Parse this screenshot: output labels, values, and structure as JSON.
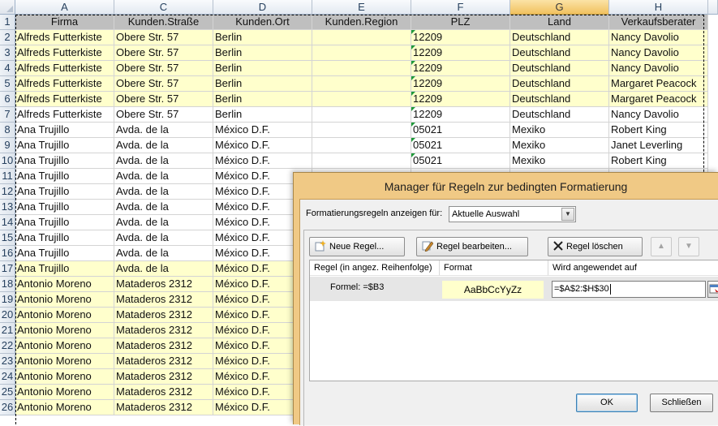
{
  "columns": [
    {
      "letter": "A",
      "header": "Firma"
    },
    {
      "letter": "C",
      "header": "Kunden.Straße"
    },
    {
      "letter": "D",
      "header": "Kunden.Ort"
    },
    {
      "letter": "E",
      "header": "Kunden.Region"
    },
    {
      "letter": "F",
      "header": "PLZ"
    },
    {
      "letter": "G",
      "header": "Land"
    },
    {
      "letter": "H",
      "header": "Verkaufsberater"
    }
  ],
  "rows": [
    {
      "num": "2",
      "hl": true,
      "cells": [
        "Alfreds Futterkiste",
        "Obere Str. 57",
        "Berlin",
        "",
        "12209",
        "Deutschland",
        "Nancy Davolio"
      ]
    },
    {
      "num": "3",
      "hl": true,
      "cells": [
        "Alfreds Futterkiste",
        "Obere Str. 57",
        "Berlin",
        "",
        "12209",
        "Deutschland",
        "Nancy Davolio"
      ]
    },
    {
      "num": "4",
      "hl": true,
      "cells": [
        "Alfreds Futterkiste",
        "Obere Str. 57",
        "Berlin",
        "",
        "12209",
        "Deutschland",
        "Nancy Davolio"
      ]
    },
    {
      "num": "5",
      "hl": true,
      "cells": [
        "Alfreds Futterkiste",
        "Obere Str. 57",
        "Berlin",
        "",
        "12209",
        "Deutschland",
        "Margaret Peacock"
      ]
    },
    {
      "num": "6",
      "hl": true,
      "cells": [
        "Alfreds Futterkiste",
        "Obere Str. 57",
        "Berlin",
        "",
        "12209",
        "Deutschland",
        "Margaret Peacock"
      ]
    },
    {
      "num": "7",
      "hl": false,
      "cells": [
        "Alfreds Futterkiste",
        "Obere Str. 57",
        "Berlin",
        "",
        "12209",
        "Deutschland",
        "Nancy Davolio"
      ]
    },
    {
      "num": "8",
      "hl": false,
      "cells": [
        "Ana Trujillo",
        "Avda. de la",
        "México D.F.",
        "",
        "05021",
        "Mexiko",
        "Robert King"
      ]
    },
    {
      "num": "9",
      "hl": false,
      "cells": [
        "Ana Trujillo",
        "Avda. de la",
        "México D.F.",
        "",
        "05021",
        "Mexiko",
        "Janet Leverling"
      ]
    },
    {
      "num": "10",
      "hl": false,
      "cells": [
        "Ana Trujillo",
        "Avda. de la",
        "México D.F.",
        "",
        "05021",
        "Mexiko",
        "Robert King"
      ]
    },
    {
      "num": "11",
      "hl": false,
      "cells": [
        "Ana Trujillo",
        "Avda. de la",
        "México D.F.",
        "",
        "",
        "",
        ""
      ]
    },
    {
      "num": "12",
      "hl": false,
      "cells": [
        "Ana Trujillo",
        "Avda. de la",
        "México D.F.",
        "",
        "",
        "",
        ""
      ]
    },
    {
      "num": "13",
      "hl": false,
      "cells": [
        "Ana Trujillo",
        "Avda. de la",
        "México D.F.",
        "",
        "",
        "",
        ""
      ]
    },
    {
      "num": "14",
      "hl": false,
      "cells": [
        "Ana Trujillo",
        "Avda. de la",
        "México D.F.",
        "",
        "",
        "",
        ""
      ]
    },
    {
      "num": "15",
      "hl": false,
      "cells": [
        "Ana Trujillo",
        "Avda. de la",
        "México D.F.",
        "",
        "",
        "",
        ""
      ]
    },
    {
      "num": "16",
      "hl": false,
      "cells": [
        "Ana Trujillo",
        "Avda. de la",
        "México D.F.",
        "",
        "",
        "",
        ""
      ]
    },
    {
      "num": "17",
      "hl": true,
      "cells": [
        "Ana Trujillo",
        "Avda. de la",
        "México D.F.",
        "",
        "",
        "",
        ""
      ]
    },
    {
      "num": "18",
      "hl": true,
      "cells": [
        "Antonio Moreno",
        "Mataderos  2312",
        "México D.F.",
        "",
        "",
        "",
        ""
      ]
    },
    {
      "num": "19",
      "hl": true,
      "cells": [
        "Antonio Moreno",
        "Mataderos  2312",
        "México D.F.",
        "",
        "",
        "",
        ""
      ]
    },
    {
      "num": "20",
      "hl": true,
      "cells": [
        "Antonio Moreno",
        "Mataderos  2312",
        "México D.F.",
        "",
        "",
        "",
        ""
      ]
    },
    {
      "num": "21",
      "hl": true,
      "cells": [
        "Antonio Moreno",
        "Mataderos  2312",
        "México D.F.",
        "",
        "",
        "",
        ""
      ]
    },
    {
      "num": "22",
      "hl": true,
      "cells": [
        "Antonio Moreno",
        "Mataderos  2312",
        "México D.F.",
        "",
        "",
        "",
        ""
      ]
    },
    {
      "num": "23",
      "hl": true,
      "cells": [
        "Antonio Moreno",
        "Mataderos  2312",
        "México D.F.",
        "",
        "",
        "",
        ""
      ]
    },
    {
      "num": "24",
      "hl": true,
      "cells": [
        "Antonio Moreno",
        "Mataderos  2312",
        "México D.F.",
        "",
        "",
        "",
        ""
      ]
    },
    {
      "num": "25",
      "hl": true,
      "cells": [
        "Antonio Moreno",
        "Mataderos  2312",
        "México D.F.",
        "",
        "",
        "",
        ""
      ]
    },
    {
      "num": "26",
      "hl": true,
      "cells": [
        "Antonio Moreno",
        "Mataderos  2312",
        "México D.F.",
        "",
        "",
        "",
        ""
      ]
    }
  ],
  "first_row_num": "1",
  "dialog": {
    "title": "Manager für Regeln zur bedingten Formatierung",
    "show_rules_label": "Formatierungsregeln anzeigen für:",
    "scope_value": "Aktuelle Auswahl",
    "new_rule": "Neue Regel...",
    "edit_rule": "Regel bearbeiten...",
    "delete_rule": "Regel löschen",
    "list_headers": {
      "rule": "Regel (in angez. Reihenfolge)",
      "format": "Format",
      "applies_to": "Wird angewendet auf"
    },
    "rule": {
      "formula": "Formel: =$B3",
      "preview": "AaBbCcYyZz",
      "range": "=$A$2:$H$30"
    },
    "ok": "OK",
    "close": "Schließen"
  },
  "colors": {
    "highlight": "#ffffcc",
    "header_highlight": "#bfbfbf",
    "selected_column": "#f1c15f",
    "dialog_frame": "#f0c985",
    "error_triangle": "#1f9a3a"
  }
}
